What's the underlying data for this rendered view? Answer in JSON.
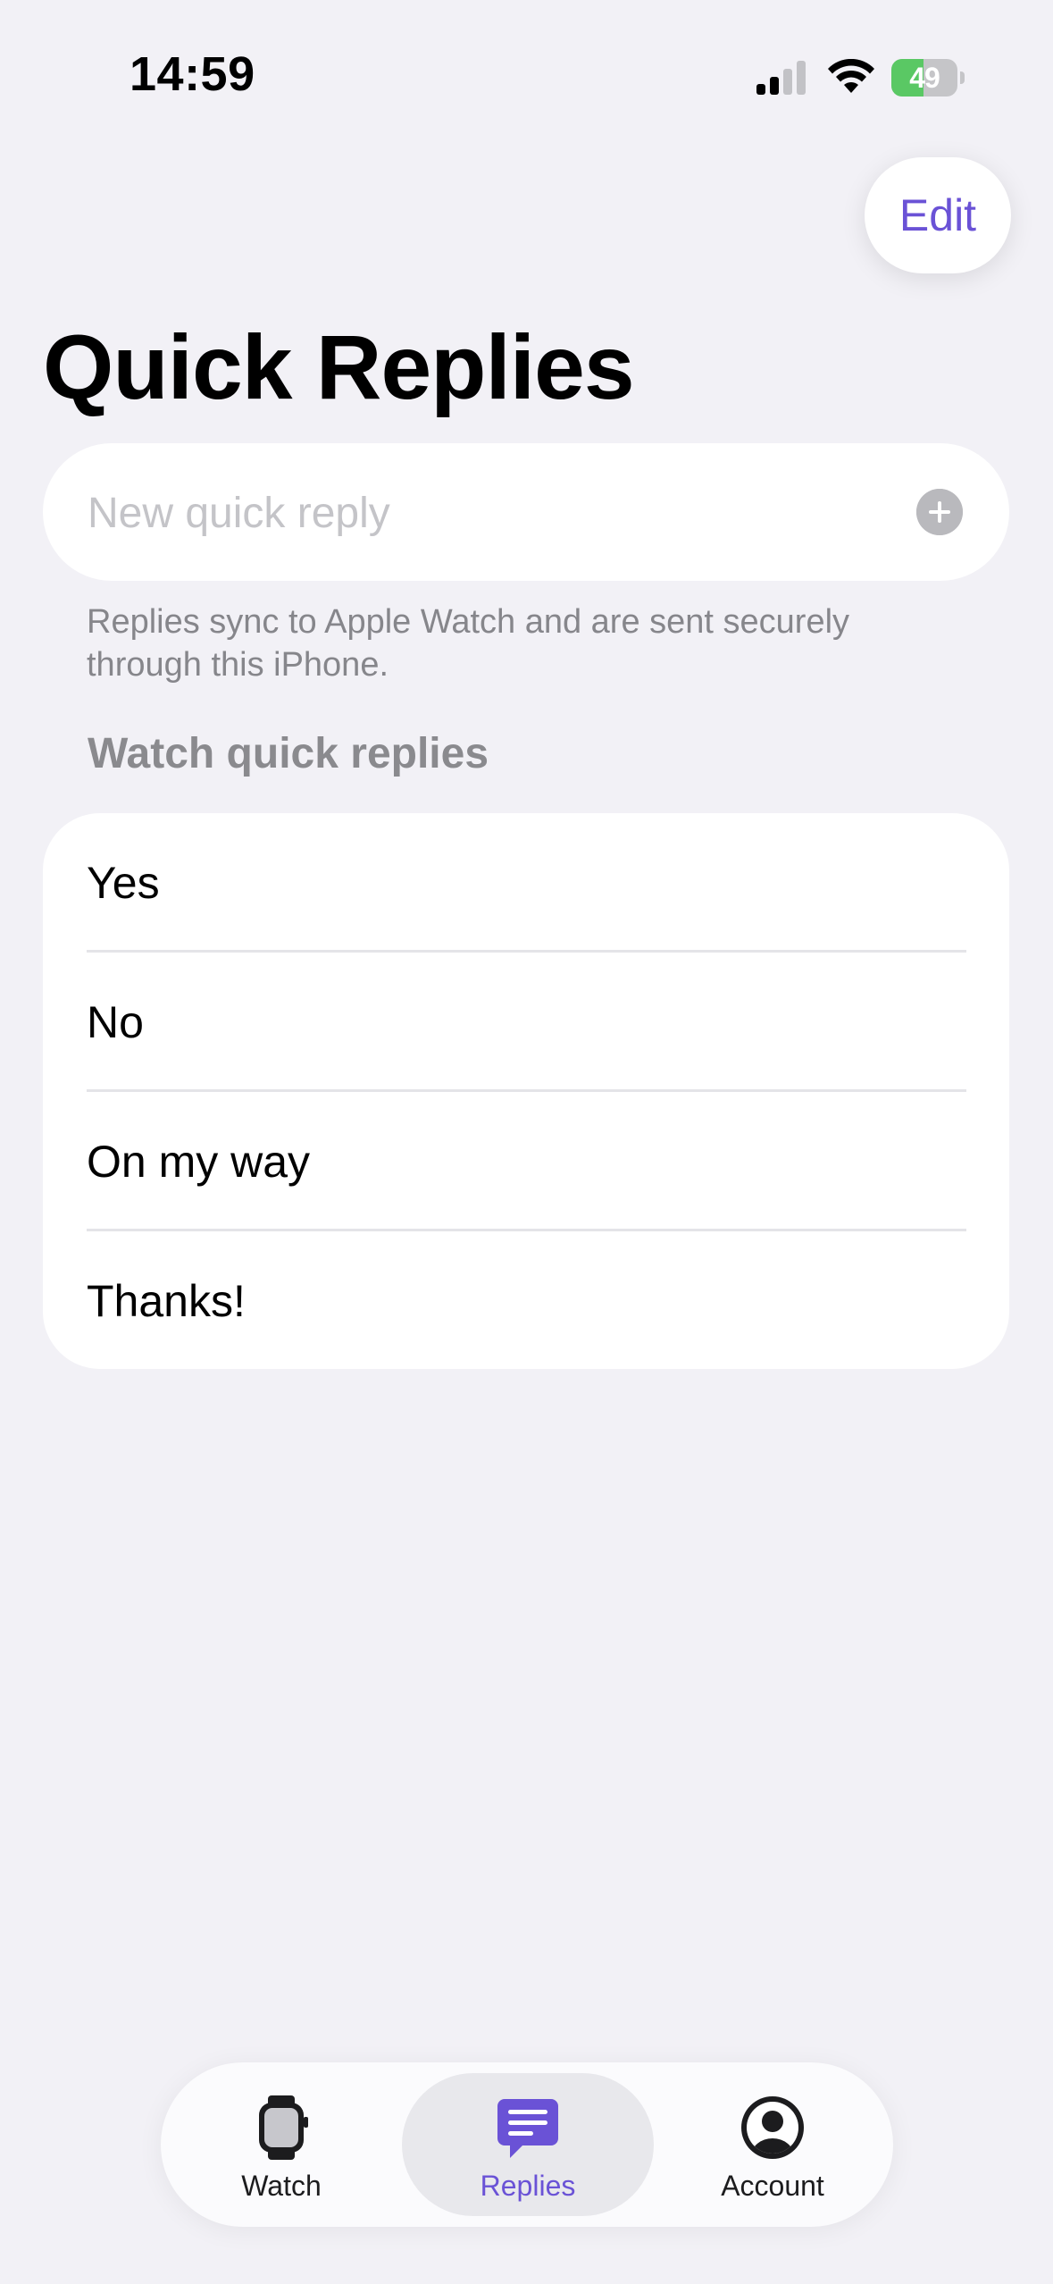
{
  "status_bar": {
    "time": "14:59",
    "battery_percent": "49",
    "battery_level": 0.49,
    "charging": true
  },
  "header": {
    "edit_label": "Edit",
    "title": "Quick Replies"
  },
  "new_reply": {
    "placeholder": "New quick reply",
    "value": "",
    "add_icon": "plus-circle-icon"
  },
  "helper_text": "Replies sync to Apple Watch and are sent securely through this iPhone.",
  "section": {
    "title": "Watch quick replies",
    "items": [
      {
        "label": "Yes"
      },
      {
        "label": "No"
      },
      {
        "label": "On my way"
      },
      {
        "label": "Thanks!"
      }
    ]
  },
  "tab_bar": {
    "tabs": [
      {
        "label": "Watch",
        "icon": "watch-icon",
        "active": false
      },
      {
        "label": "Replies",
        "icon": "message-icon",
        "active": true
      },
      {
        "label": "Account",
        "icon": "person-circle-icon",
        "active": false
      }
    ]
  },
  "colors": {
    "accent": "#6a52d6",
    "background": "#f2f1f6",
    "battery_green": "#5ac864"
  }
}
